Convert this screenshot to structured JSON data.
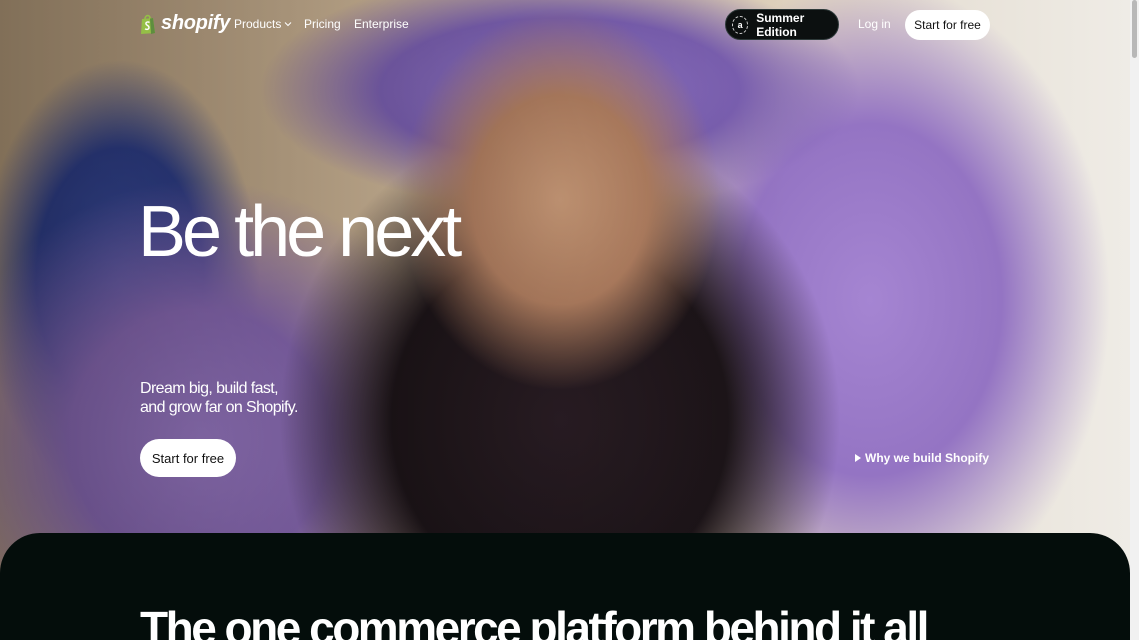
{
  "nav": {
    "logo_text": "shopify",
    "products_label": "Products",
    "pricing_label": "Pricing",
    "enterprise_label": "Enterprise",
    "summer_badge": "a",
    "summer_label": "Summer Edition",
    "login_label": "Log in",
    "cta_label": "Start for free"
  },
  "hero": {
    "headline": "Be the next",
    "subtext": "Dream big, build fast, and grow far on Shopify.",
    "cta_label": "Start for free",
    "video_link_label": "Why we build Shopify"
  },
  "section": {
    "title": "The one commerce platform behind it all"
  },
  "colors": {
    "brand_green": "#95bf47",
    "dark_bg": "#040d0b",
    "accent_purple": "#9474c3"
  },
  "icons": {
    "logo": "shopify-bag-icon",
    "products_caret": "chevron-down-icon",
    "video_link": "play-icon"
  }
}
